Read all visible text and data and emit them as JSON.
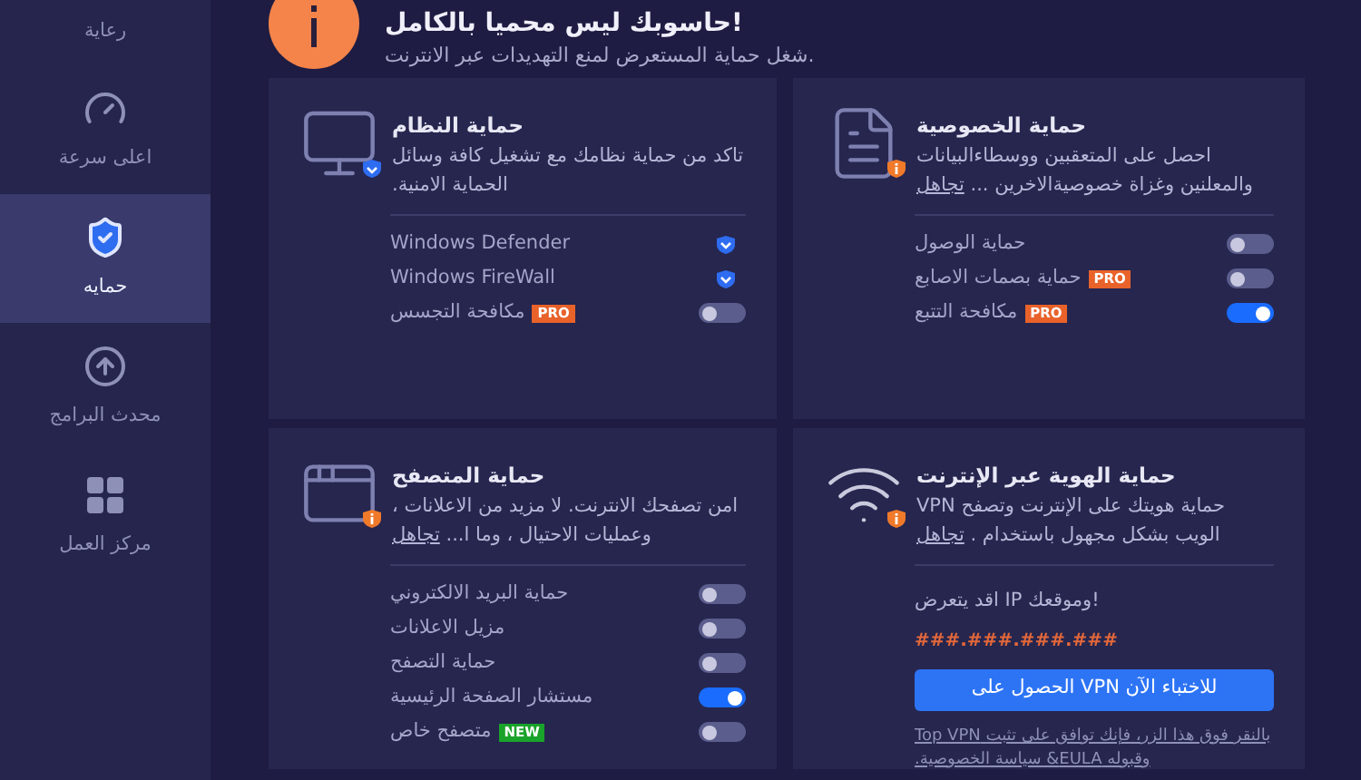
{
  "sidebar": {
    "items": [
      {
        "label": "رعاية",
        "kind": "none",
        "selected": false
      },
      {
        "label": "اعلى سرعة",
        "kind": "gauge",
        "selected": false
      },
      {
        "label": "حمايه",
        "kind": "shield",
        "selected": true
      },
      {
        "label": "محدث البرامج",
        "kind": "update",
        "selected": false
      },
      {
        "label": "مركز العمل",
        "kind": "grid",
        "selected": false
      }
    ]
  },
  "header": {
    "title": "حاسوبك ليس محميا بالكامل!",
    "subtitle": "شغل حماية المستعرض لمنع التهديدات عبر الانترنت."
  },
  "cards": [
    {
      "kind": "toggles",
      "badge_alert": true,
      "title": "حماية الخصوصية",
      "description": "احصل على المتعقبين ووسطاءالبيانات والمعلنين وغزاة خصوصيةالاخرين ...",
      "link": "تجاهل",
      "rows": [
        {
          "label": "حماية الوصول",
          "kind": "toggle",
          "on": false
        },
        {
          "label": "حماية بصمات الاصابع",
          "kind": "toggle",
          "on": false,
          "badge": {
            "text": "PRO",
            "color": "#e8622a"
          }
        },
        {
          "label": "مكافحة التتبع",
          "kind": "toggle",
          "on": true,
          "badge": {
            "text": "PRO",
            "color": "#e8622a"
          }
        }
      ]
    },
    {
      "kind": "toggles",
      "badge_alert": false,
      "title": "حماية النظام",
      "description": "تاكد من حماية نظامك مع تشغيل كافة وسائل الحماية الامنية.",
      "rows": [
        {
          "label": "Windows Defender",
          "kind": "shield",
          "on": true
        },
        {
          "label": "Windows FireWall",
          "kind": "shield",
          "on": true
        },
        {
          "label": "مكافحة التجسس",
          "kind": "toggle",
          "on": false,
          "badge": {
            "text": "PRO",
            "color": "#e8622a"
          }
        }
      ]
    },
    {
      "kind": "vpn",
      "badge_alert": true,
      "title": "حماية الهوية عبر الإنترنت",
      "description": "حماية هويتك على الإنترنت وتصفح VPN الويب بشكل مجهول باستخدام .",
      "link": "تجاهل",
      "warning": "اقد يتعرض IP وموقعك!",
      "ip": "###.###.###.###",
      "button": "الحصول على VPN للاختباء الآن",
      "legal": "بالنقر فوق هذا الزر، فإنك توافق على تثبت Top VPN وقبوله EULA& سياسة الخصوصية."
    },
    {
      "kind": "toggles",
      "badge_alert": true,
      "title": "حماية المتصفح",
      "description": "امن تصفحك الانترنت. لا مزيد من الاعلانات ، وعمليات الاحتيال ، وما ا...",
      "link": "تجاهل",
      "rows": [
        {
          "label": "حماية البريد الالكتروني",
          "kind": "toggle",
          "on": false
        },
        {
          "label": "مزيل الاعلانات",
          "kind": "toggle",
          "on": false
        },
        {
          "label": "حماية التصفح",
          "kind": "toggle",
          "on": false
        },
        {
          "label": "مستشار الصفحة الرئيسية",
          "kind": "toggle",
          "on": true
        },
        {
          "label": "متصفح خاص",
          "kind": "toggle",
          "on": false,
          "badge": {
            "text": "NEW",
            "color": "#1aa32a"
          }
        }
      ]
    }
  ]
}
